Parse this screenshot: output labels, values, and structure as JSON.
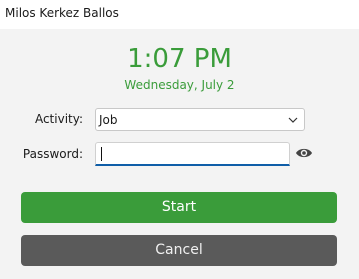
{
  "window": {
    "title": "Milos Kerkez Ballos"
  },
  "clock": {
    "time": "1:07 PM",
    "date": "Wednesday, July 2"
  },
  "form": {
    "activity_label": "Activity:",
    "activity_value": "Job",
    "password_label": "Password:",
    "password_value": ""
  },
  "buttons": {
    "start": "Start",
    "cancel": "Cancel"
  },
  "icons": {
    "dropdown": "chevron-down-icon",
    "reveal_password": "eye-icon"
  },
  "colors": {
    "accent_green": "#3a9c3a",
    "cancel_gray": "#5a5a5a",
    "focus_blue": "#0f5ea8"
  }
}
